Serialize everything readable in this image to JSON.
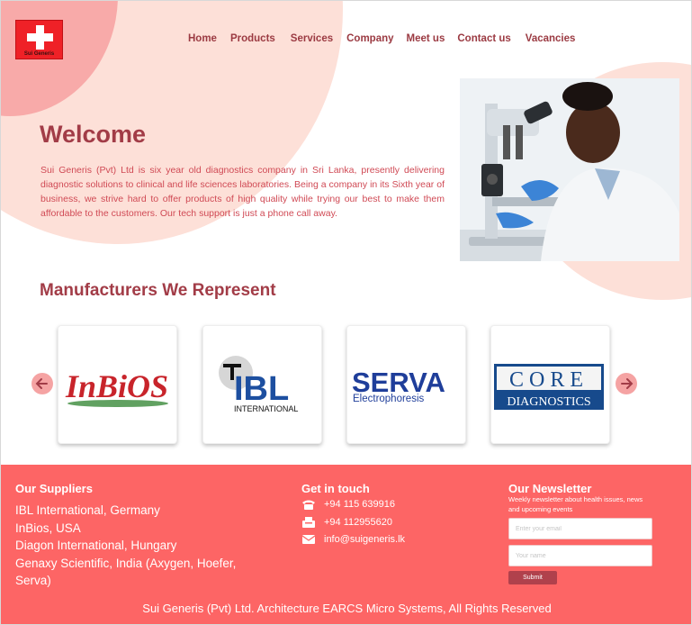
{
  "brand": {
    "logo_text": "Sui Generis"
  },
  "nav": {
    "items": [
      "Home",
      "Products",
      "Services",
      "Company",
      "Meet us",
      "Contact us",
      "Vacancies"
    ]
  },
  "hero": {
    "title": "Welcome",
    "intro": "Sui Generis (Pvt) Ltd is six year old diagnostics company in Sri Lanka,  presently delivering diagnostic solutions to clinical and life sciences  laboratories. Being a company in its Sixth year of business, we strive  hard to offer products of high quality while trying our best to make  them affordable to the customers. Our tech support is just a phone call  away."
  },
  "manufacturers": {
    "title": "Manufacturers We Represent",
    "logos": [
      {
        "name": "InBiOS"
      },
      {
        "name": "IBL",
        "sub": "INTERNATIONAL"
      },
      {
        "name": "SERVA",
        "sub": "Electrophoresis"
      },
      {
        "name": "CORE",
        "sub": "DIAGNOSTICS"
      }
    ]
  },
  "footer": {
    "suppliers_title": "Our Suppliers",
    "suppliers": [
      "IBL International, Germany",
      "InBios, USA",
      "Diagon International, Hungary",
      "Genaxy Scientific, India (Axygen, Hoefer, Serva)"
    ],
    "contact_title": "Get in touch",
    "phone": "+94 115 639916",
    "fax": "+94 112955620",
    "email": "info@suigeneris.lk",
    "newsletter_title": "Our Newsletter",
    "newsletter_sub": "Weekly newsletter about health issues, news and upcoming events",
    "email_placeholder": "Enter your email",
    "name_placeholder": "Your name",
    "submit_label": "Submit",
    "copyright": "Sui Generis (Pvt) Ltd. Architecture EARCS Micro Systems, All Rights Reserved"
  },
  "colors": {
    "brand_red": "#fd6565",
    "heading": "#a23c47",
    "nav": "#9b3a42",
    "body_text": "#d04a55",
    "blush": "#fde0d8"
  }
}
